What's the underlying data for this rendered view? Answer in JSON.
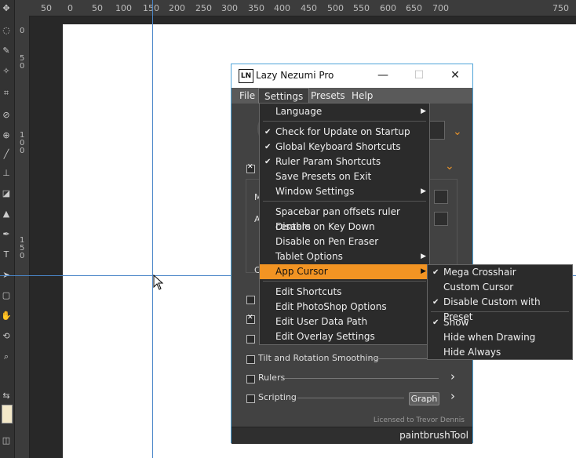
{
  "ruler": {
    "h_labels": [
      "50",
      "0",
      "50",
      "100",
      "150",
      "200",
      "250",
      "300",
      "350",
      "400",
      "450",
      "500",
      "550",
      "600",
      "650",
      "700",
      "750"
    ],
    "v_labels": [
      "0",
      "5",
      "0",
      "1",
      "0",
      "0",
      "1",
      "5",
      "0"
    ]
  },
  "panel": {
    "logo": "LN",
    "title": "Lazy Nezumi Pro",
    "menu": [
      "File",
      "Settings",
      "Presets",
      "Help"
    ],
    "rows": [
      {
        "label": "Tilt and Rotation Smoothing",
        "checked": false
      },
      {
        "label": "Rulers",
        "checked": false
      },
      {
        "label": "Scripting",
        "checked": false
      }
    ],
    "graph_button": "Graph",
    "licensed": "Licensed to Trevor Dennis",
    "status": "paintbrushTool",
    "left_stubs": [
      "M",
      "A",
      "C"
    ]
  },
  "settings_menu": {
    "items": [
      {
        "label": "Language",
        "checked": false,
        "submenu": true
      },
      {
        "label": "Check for Update on Startup",
        "checked": true,
        "submenu": false
      },
      {
        "label": "Global Keyboard Shortcuts",
        "checked": true,
        "submenu": false
      },
      {
        "label": "Ruler Param Shortcuts",
        "checked": true,
        "submenu": false
      },
      {
        "label": "Save Presets on Exit",
        "checked": false,
        "submenu": false
      },
      {
        "label": "Window Settings",
        "checked": false,
        "submenu": true
      },
      {
        "label": "Spacebar pan offsets ruler centers",
        "checked": false,
        "submenu": false
      },
      {
        "label": "Disable on Key Down",
        "checked": false,
        "submenu": false
      },
      {
        "label": "Disable on Pen Eraser",
        "checked": false,
        "submenu": false
      },
      {
        "label": "Tablet Options",
        "checked": false,
        "submenu": true
      },
      {
        "label": "App Cursor",
        "checked": false,
        "submenu": true,
        "highlighted": true
      },
      {
        "label": "Edit Shortcuts",
        "checked": false,
        "submenu": false
      },
      {
        "label": "Edit PhotoShop Options",
        "checked": false,
        "submenu": false
      },
      {
        "label": "Edit User Data Path",
        "checked": false,
        "submenu": false
      },
      {
        "label": "Edit Overlay Settings",
        "checked": false,
        "submenu": false
      }
    ]
  },
  "cursor_submenu": {
    "items": [
      {
        "label": "Mega Crosshair",
        "checked": true
      },
      {
        "label": "Custom Cursor",
        "checked": false
      },
      {
        "label": "Disable Custom with Preset",
        "checked": true
      },
      {
        "label": "Show",
        "checked": true
      },
      {
        "label": "Hide when Drawing",
        "checked": false
      },
      {
        "label": "Hide Always",
        "checked": false
      }
    ]
  },
  "colors": {
    "accent": "#f29423",
    "guide": "#4a86c8",
    "window_border": "#4ea3d8"
  }
}
